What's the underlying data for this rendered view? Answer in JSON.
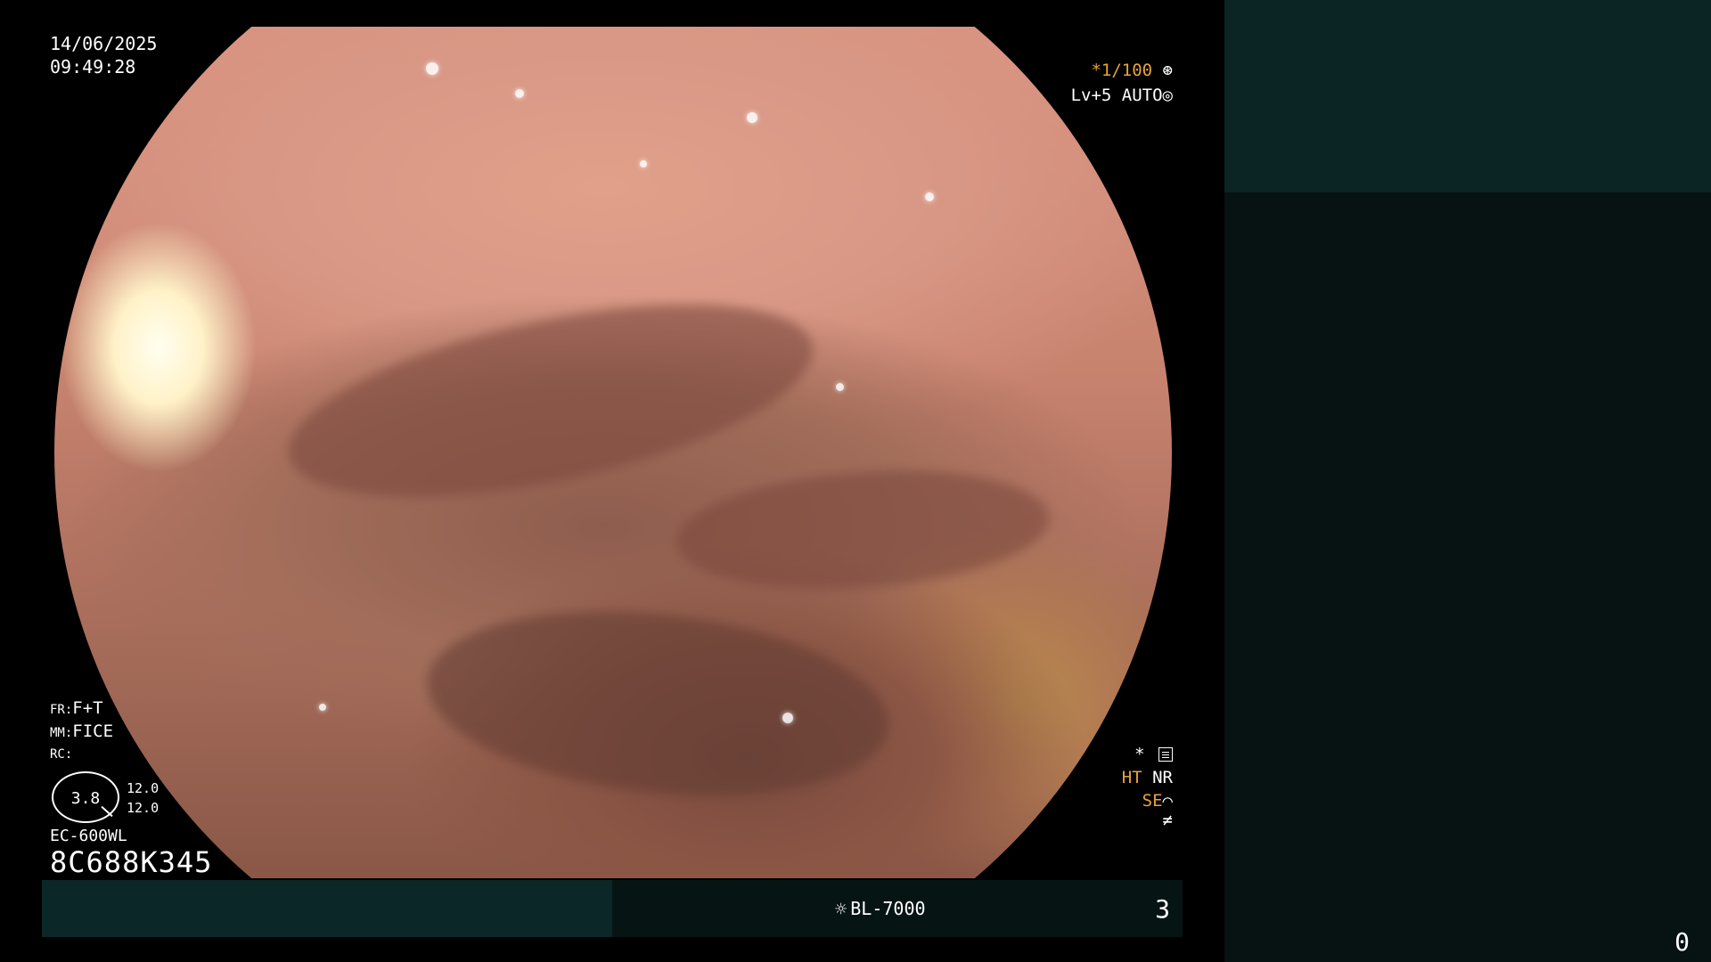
{
  "datetime": {
    "date": "14/06/2025",
    "time": "09:49:28"
  },
  "status_top_right": {
    "shutter": "*1/100",
    "shutter_icon": "aperture-icon",
    "iris_level": "Lv+5",
    "iris_mode": "AUTO",
    "iris_icon": "iris-icon"
  },
  "settings_left": {
    "fr_key": "FR:",
    "fr_value": "F+T",
    "mm_key": "MM:",
    "mm_value": "FICE",
    "rc_key": "RC:",
    "rc_value": ""
  },
  "zoom": {
    "value": "3.8",
    "max_1": "12.0",
    "max_2": "12.0"
  },
  "scope": {
    "model": "EC-600WL",
    "serial": "8C688K345"
  },
  "status_bottom_right": {
    "star": "*",
    "settings_icon": "menu-box-icon",
    "ht": "HT",
    "nr": "NR",
    "se": "SE",
    "se_icon": "enhance-curve-icon",
    "freq_icon": "not-equal-icon",
    "freq_symbol": "≠"
  },
  "bottom_bar": {
    "light_icon": "sun-icon",
    "light_source": "BL-7000",
    "count": "3"
  },
  "side_panel": {
    "count": "0"
  },
  "colors": {
    "accent_orange": "#e8a33a",
    "panel_teal": "#0b2727",
    "panel_dark": "#071414"
  }
}
